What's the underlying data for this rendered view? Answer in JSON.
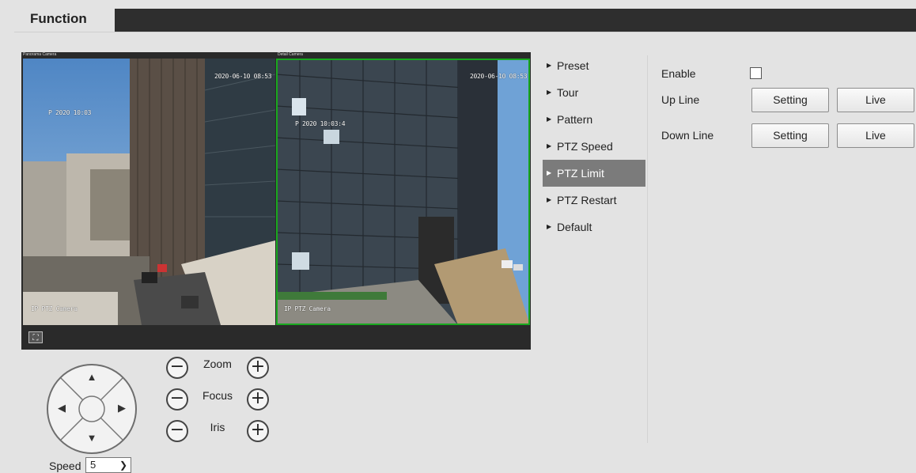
{
  "header": {
    "tab_label": "Function"
  },
  "video": {
    "left_pane": {
      "title": "Panorama Camera",
      "timestamp": "2020-06-10 08:53",
      "osd_top_left": "P 2020 10:03",
      "channel_label": "IP PTZ Camera"
    },
    "right_pane": {
      "title": "Detail Camera",
      "timestamp": "2020-06-10 08:53",
      "osd_top_left": "P 2020 10:03:4",
      "channel_label": "IP PTZ Camera"
    },
    "fullscreen_icon": "fullscreen-icon"
  },
  "ptz": {
    "zoom_label": "Zoom",
    "focus_label": "Focus",
    "iris_label": "Iris",
    "minus": "−",
    "plus": "+",
    "speed_label": "Speed",
    "speed_value": "5"
  },
  "menu": {
    "items": [
      {
        "label": "Preset",
        "active": false
      },
      {
        "label": "Tour",
        "active": false
      },
      {
        "label": "Pattern",
        "active": false
      },
      {
        "label": "PTZ Speed",
        "active": false
      },
      {
        "label": "PTZ Limit",
        "active": true
      },
      {
        "label": "PTZ Restart",
        "active": false
      },
      {
        "label": "Default",
        "active": false
      }
    ]
  },
  "config": {
    "enable_label": "Enable",
    "enable_checked": false,
    "up_line_label": "Up Line",
    "down_line_label": "Down Line",
    "setting_label": "Setting",
    "live_label": "Live"
  },
  "colors": {
    "active_menu": "#7b7b7b",
    "selection_border": "#19a81f",
    "tab_bar": "#2e2e2e"
  }
}
